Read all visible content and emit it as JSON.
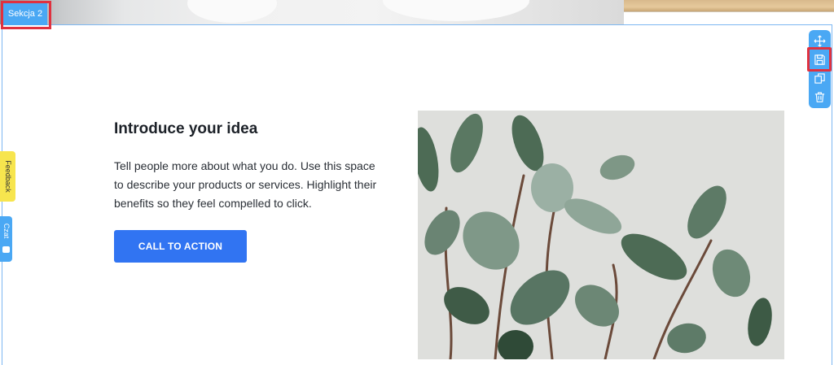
{
  "section": {
    "tag_label": "Sekcja 2"
  },
  "toolbar": {
    "items": [
      {
        "icon": "move-icon"
      },
      {
        "icon": "save-icon"
      },
      {
        "icon": "duplicate-icon"
      },
      {
        "icon": "delete-icon"
      }
    ],
    "accent": "#4aa8f4",
    "highlight": "#e0313f"
  },
  "side_tabs": {
    "feedback_label": "Feedback",
    "chat_label": "Czat"
  },
  "content": {
    "heading": "Introduce your idea",
    "body": "Tell people more about what you do. Use this space to describe your products or services. Highlight their benefits so they feel compelled to click.",
    "cta_label": "CALL TO ACTION",
    "cta_color": "#3174f2"
  },
  "image": {
    "subject": "green-ficus-plant"
  }
}
